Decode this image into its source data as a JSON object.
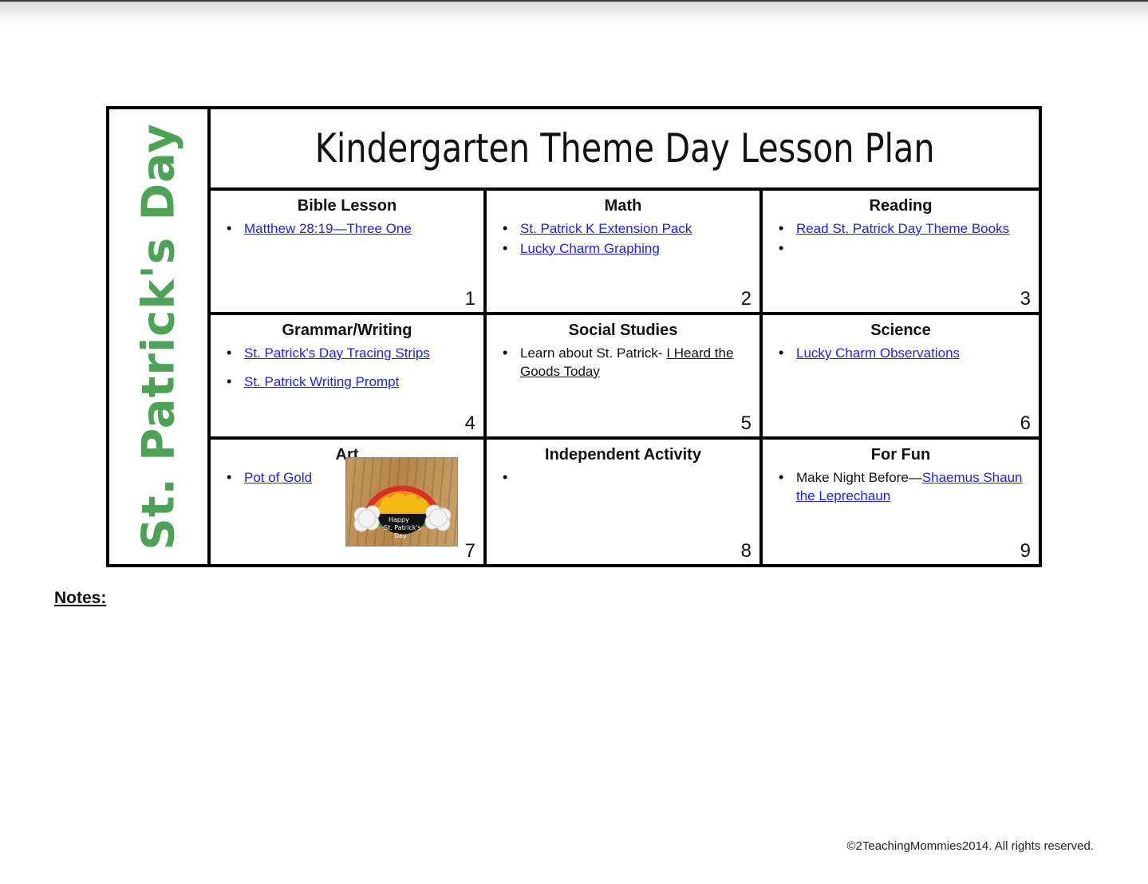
{
  "banner": {
    "text": "St. Patrick's Day",
    "color": "#4CA355"
  },
  "header": {
    "title": "Kindergarten Theme Day Lesson Plan"
  },
  "link_color": "#2121DE",
  "cells": [
    {
      "number": "1",
      "title": "Bible Lesson",
      "items": [
        {
          "link_text": "Matthew 28:19—Three One"
        }
      ]
    },
    {
      "number": "2",
      "title": "Math",
      "items": [
        {
          "link_text": "St. Patrick K Extension Pack"
        },
        {
          "link_text": "Lucky Charm Graphing"
        }
      ]
    },
    {
      "number": "3",
      "title": "Reading",
      "items": [
        {
          "link_text": "Read St. Patrick Day Theme Books"
        },
        {
          "link_text": ""
        }
      ]
    },
    {
      "number": "4",
      "title": "Grammar/Writing",
      "items": [
        {
          "link_text": "St. Patrick's Day Tracing Strips"
        },
        {
          "link_text": "St. Patrick Writing Prompt"
        }
      ]
    },
    {
      "number": "5",
      "title": "Social Studies",
      "items": [
        {
          "plain_text": "Learn about St. Patrick- ",
          "underlined_text": "I Heard the Goods Today"
        }
      ]
    },
    {
      "number": "6",
      "title": "Science",
      "items": [
        {
          "link_text": "Lucky Charm Observations"
        }
      ]
    },
    {
      "number": "7",
      "title": "Art",
      "items": [
        {
          "link_text": "Pot of Gold"
        }
      ],
      "photo": {
        "caption_line1": "Happy",
        "caption_line2": "St. Patrick's",
        "caption_line3": "Day",
        "description": "pot-of-gold-rainbow-craft"
      }
    },
    {
      "number": "8",
      "title": "Independent Activity",
      "items": [
        {
          "plain_text": ""
        }
      ]
    },
    {
      "number": "9",
      "title": "For Fun",
      "items": [
        {
          "plain_text": "Make Night Before—",
          "link_text": "Shaemus Shaun the Leprechaun"
        }
      ]
    }
  ],
  "notes": {
    "label": "Notes:"
  },
  "footer": {
    "copyright": "©2TeachingMommies2014. All rights reserved."
  }
}
